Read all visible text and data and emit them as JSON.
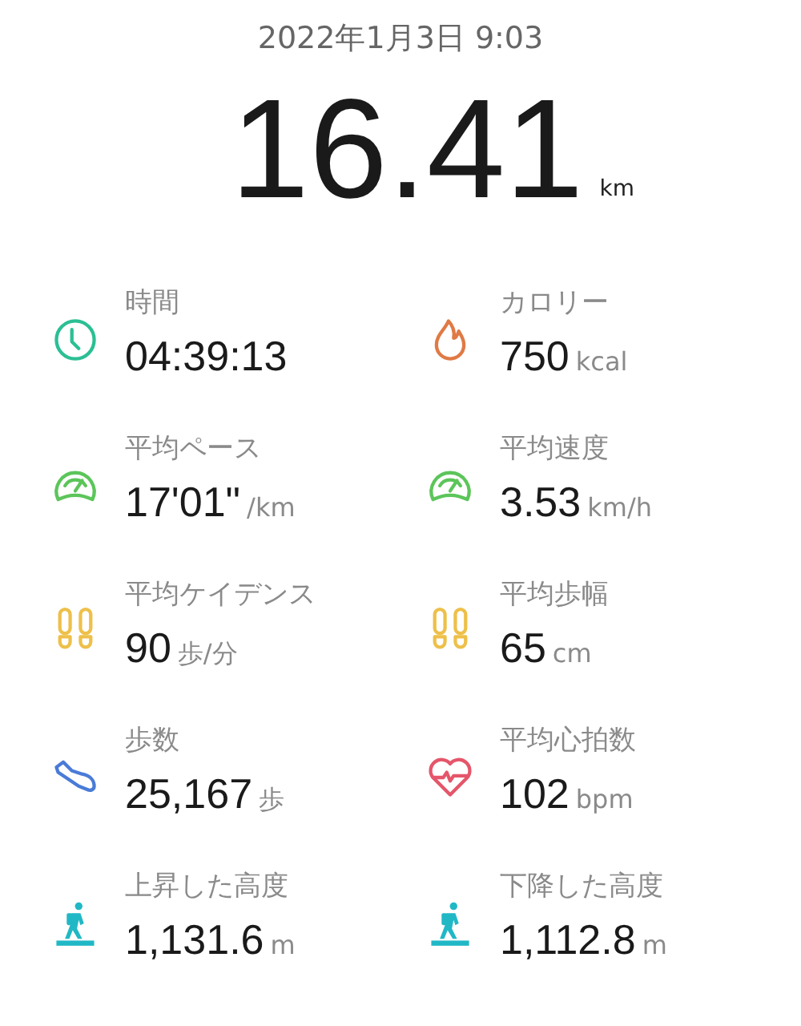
{
  "date": "2022年1月3日 9:03",
  "distance": {
    "value": "16.41",
    "unit": "km"
  },
  "stats": [
    {
      "label": "時間",
      "value": "04:39:13"
    },
    {
      "label": "カロリー",
      "value": "750",
      "unit": "kcal"
    },
    {
      "label": "平均ペース",
      "value": "17'01\"",
      "unit": "/km"
    },
    {
      "label": "平均速度",
      "value": "3.53",
      "unit": "km/h"
    },
    {
      "label": "平均ケイデンス",
      "value": "90",
      "unit": "歩/分"
    },
    {
      "label": "平均歩幅",
      "value": "65",
      "unit": "cm"
    },
    {
      "label": "歩数",
      "value": "25,167",
      "unit": "歩"
    },
    {
      "label": "平均心拍数",
      "value": "102",
      "unit": "bpm"
    },
    {
      "label": "上昇した高度",
      "value": "1,131.6",
      "unit": "m"
    },
    {
      "label": "下降した高度",
      "value": "1,112.8",
      "unit": "m"
    }
  ]
}
